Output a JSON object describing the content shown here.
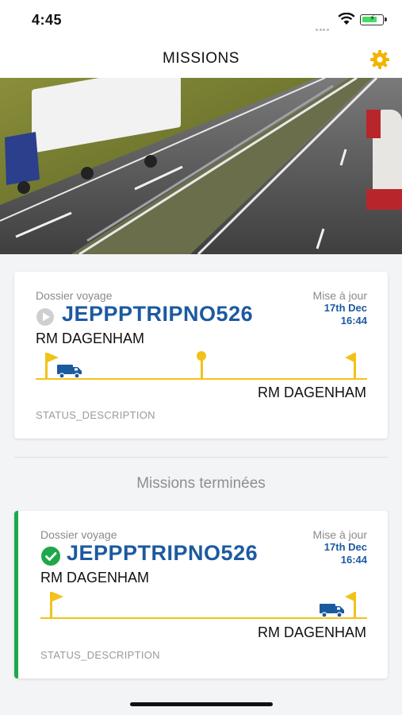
{
  "status_bar": {
    "time": "4:45",
    "icons": [
      "signal-icon",
      "wifi-icon",
      "battery-charging-icon"
    ]
  },
  "header": {
    "title": "MISSIONS",
    "settings_icon": "gear-icon",
    "accent_color": "#f2b400"
  },
  "hero": {
    "description_icon": "highway-trucks-photo"
  },
  "active_mission": {
    "label": "Dossier voyage",
    "update_label": "Mise à jour",
    "update_date": "17th Dec",
    "update_time": "16:44",
    "trip_id": "JEPPPTRIPNO526",
    "status_icon": "play-icon",
    "origin": "RM DAGENHAM",
    "destination": "RM DAGENHAM",
    "status": "STATUS_DESCRIPTION",
    "progress": 0.05
  },
  "completed_section": {
    "title": "Missions terminées"
  },
  "completed_missions": [
    {
      "label": "Dossier voyage",
      "update_label": "Mise à jour",
      "update_date": "17th Dec",
      "update_time": "16:44",
      "trip_id": "JEPPPTRIPNO526",
      "status_icon": "check-circle-icon",
      "origin": "RM DAGENHAM",
      "destination": "RM DAGENHAM",
      "status": "STATUS_DESCRIPTION",
      "progress": 0.95
    }
  ],
  "colors": {
    "brand_blue": "#1c5aa0",
    "track_yellow": "#f2c21b",
    "done_green": "#1ea84b"
  }
}
